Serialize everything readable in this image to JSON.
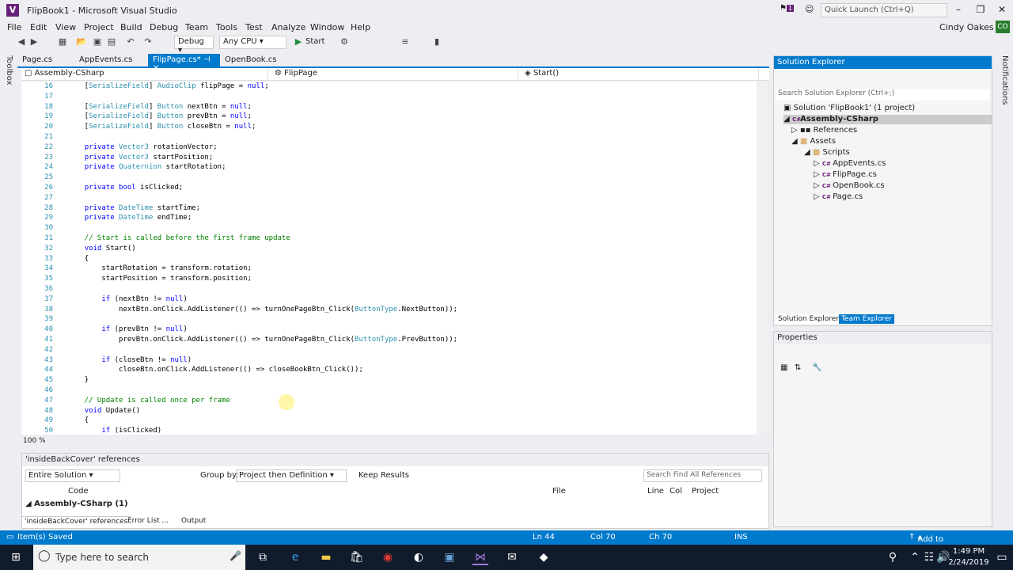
{
  "window": {
    "title": "FlipBook1 - Microsoft Visual Studio",
    "quick_launch": "Quick Launch (Ctrl+Q)",
    "user": "Cindy Oakes",
    "user_initials": "CO",
    "notification_count": "1"
  },
  "menu": [
    "File",
    "Edit",
    "View",
    "Project",
    "Build",
    "Debug",
    "Team",
    "Tools",
    "Test",
    "Analyze",
    "Window",
    "Help"
  ],
  "toolbar": {
    "config": "Debug",
    "platform": "Any CPU",
    "start": "Start"
  },
  "left_strip": "Toolbox",
  "right_strip": "Notifications",
  "tabs": [
    {
      "label": "Page.cs"
    },
    {
      "label": "AppEvents.cs"
    },
    {
      "label": "FlipPage.cs*"
    },
    {
      "label": "OpenBook.cs"
    }
  ],
  "navbar": {
    "project": "Assembly-CSharp",
    "class": "FlipPage",
    "member": "Start()"
  },
  "code_lines": [
    {
      "n": "16",
      "t": "    [SerializeField] AudioClip flipPage = null;"
    },
    {
      "n": "17",
      "t": ""
    },
    {
      "n": "18",
      "t": "    [SerializeField] Button nextBtn = null;"
    },
    {
      "n": "19",
      "t": "    [SerializeField] Button prevBtn = null;"
    },
    {
      "n": "20",
      "t": "    [SerializeField] Button closeBtn = null;"
    },
    {
      "n": "21",
      "t": ""
    },
    {
      "n": "22",
      "t": "    private Vector3 rotationVector;"
    },
    {
      "n": "23",
      "t": "    private Vector3 startPosition;"
    },
    {
      "n": "24",
      "t": "    private Quaternion startRotation;"
    },
    {
      "n": "25",
      "t": ""
    },
    {
      "n": "26",
      "t": "    private bool isClicked;"
    },
    {
      "n": "27",
      "t": ""
    },
    {
      "n": "28",
      "t": "    private DateTime startTime;"
    },
    {
      "n": "29",
      "t": "    private DateTime endTime;"
    },
    {
      "n": "30",
      "t": ""
    },
    {
      "n": "31",
      "t": "    // Start is called before the first frame update"
    },
    {
      "n": "32",
      "t": "    void Start()"
    },
    {
      "n": "33",
      "t": "    {"
    },
    {
      "n": "34",
      "t": "        startRotation = transform.rotation;"
    },
    {
      "n": "35",
      "t": "        startPosition = transform.position;"
    },
    {
      "n": "36",
      "t": ""
    },
    {
      "n": "37",
      "t": "        if (nextBtn != null)"
    },
    {
      "n": "38",
      "t": "            nextBtn.onClick.AddListener(() => turnOnePageBtn_Click(ButtonType.NextButton));"
    },
    {
      "n": "39",
      "t": ""
    },
    {
      "n": "40",
      "t": "        if (prevBtn != null)"
    },
    {
      "n": "41",
      "t": "            prevBtn.onClick.AddListener(() => turnOnePageBtn_Click(ButtonType.PrevButton));"
    },
    {
      "n": "42",
      "t": ""
    },
    {
      "n": "43",
      "t": "        if (closeBtn != null)"
    },
    {
      "n": "44",
      "t": "            closeBtn.onClick.AddListener(() => closeBookBtn_Click());"
    },
    {
      "n": "45",
      "t": "    }"
    },
    {
      "n": "46",
      "t": ""
    },
    {
      "n": "47",
      "t": "    // Update is called once per frame"
    },
    {
      "n": "48",
      "t": "    void Update()"
    },
    {
      "n": "49",
      "t": "    {"
    },
    {
      "n": "50",
      "t": "        if (isClicked)"
    }
  ],
  "editor_zoom": "100 %",
  "refs_panel": {
    "title": "'insideBackCover' references",
    "scope": "Entire Solution",
    "group_by_label": "Group by:",
    "group_by": "Project then Definition",
    "keep_results": "Keep Results",
    "search": "Search Find All References",
    "columns": [
      "Code",
      "File",
      "Line",
      "Col",
      "Project"
    ],
    "row": "Assembly-CSharp (1)",
    "bottom_tabs": [
      "'insideBackCover' references",
      "Error List ...",
      "Output"
    ]
  },
  "solution_explorer": {
    "title": "Solution Explorer",
    "search": "Search Solution Explorer (Ctrl+;)",
    "items": [
      {
        "label": "Solution 'FlipBook1' (1 project)"
      },
      {
        "label": "Assembly-CSharp"
      },
      {
        "label": "References"
      },
      {
        "label": "Assets"
      },
      {
        "label": "Scripts"
      },
      {
        "label": "AppEvents.cs"
      },
      {
        "label": "FlipPage.cs"
      },
      {
        "label": "OpenBook.cs"
      },
      {
        "label": "Page.cs"
      }
    ],
    "bottom_tabs": [
      "Solution Explorer",
      "Team Explorer"
    ]
  },
  "properties": {
    "title": "Properties"
  },
  "status": {
    "message": "Item(s) Saved",
    "ln": "Ln 44",
    "col": "Col 70",
    "ch": "Ch 70",
    "mode": "INS",
    "source_control": "Add to Source Control"
  },
  "taskbar": {
    "search": "Type here to search",
    "time": "1:49 PM",
    "date": "2/24/2019"
  }
}
